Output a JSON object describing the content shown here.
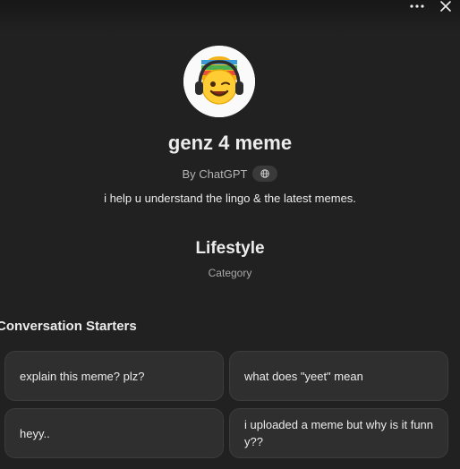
{
  "window": {
    "more_icon": "ellipsis-icon",
    "close_icon": "close-icon"
  },
  "gpt": {
    "name": "genz 4 meme",
    "byline": "By ChatGPT",
    "byline_icon": "globe-icon",
    "description": "i help u understand the lingo & the latest memes.",
    "avatar": "emoji-with-headphones-avatar"
  },
  "category": {
    "value": "Lifestyle",
    "label": "Category"
  },
  "starters": {
    "heading": "Conversation Starters",
    "items": [
      "explain this meme? plz?",
      "what does \"yeet\" mean",
      "heyy..",
      "i uploaded a meme but why is it funny??"
    ]
  },
  "colors": {
    "background": "#212121",
    "card": "#2f2f2f",
    "text": "#ececec",
    "muted": "#b4b4b4"
  }
}
